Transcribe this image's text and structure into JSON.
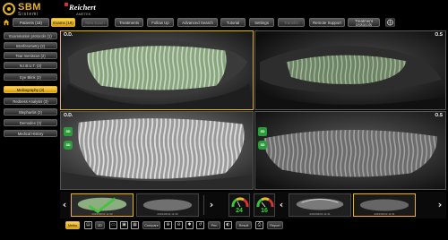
{
  "app": {
    "brand": "SBM",
    "brand_sub": "Sistemi",
    "partner": "Reichert",
    "partner_sub": "AMETEK"
  },
  "tabs": [
    {
      "label": "Patients (18)",
      "state": "normal"
    },
    {
      "label": "Exams (19)",
      "state": "active"
    },
    {
      "label": "New Exam",
      "state": "disabled"
    },
    {
      "label": "Treatments",
      "state": "normal"
    },
    {
      "label": "Follow Up",
      "state": "normal"
    },
    {
      "label": "Advanced Search",
      "state": "normal"
    },
    {
      "label": "Tutorial",
      "state": "normal"
    },
    {
      "label": "Settings",
      "state": "normal"
    },
    {
      "label": "Transfer",
      "state": "disabled"
    },
    {
      "label": "Remote Support",
      "state": "normal"
    },
    {
      "label_line1": "Treatment",
      "label_line2": "protocols",
      "state": "normal"
    }
  ],
  "sidebar": {
    "items": [
      {
        "label": "Examination protocols (1)",
        "active": false
      },
      {
        "label": "Interferometry (2)",
        "active": false
      },
      {
        "label": "Tear meniscus (2)",
        "active": false
      },
      {
        "label": "N.I.B.U.T. (3)",
        "active": false
      },
      {
        "label": "Eye Blink (2)",
        "active": false
      },
      {
        "label": "Meibography (3)",
        "active": true
      },
      {
        "label": "Redness Analysis (3)",
        "active": false
      },
      {
        "label": "Blepharitis (2)",
        "active": false
      },
      {
        "label": "Demodex (3)",
        "active": false
      },
      {
        "label": "Medical History",
        "active": false
      }
    ]
  },
  "grid": {
    "cells": [
      {
        "eye": "O.D.",
        "kind": "upper-lid",
        "selected": true
      },
      {
        "eye": "O.S",
        "kind": "upper-lid-dark",
        "selected": false
      },
      {
        "eye": "O.D.",
        "kind": "lower-lid",
        "selected": false,
        "badge_top": "3D",
        "badge_bottom": "3D"
      },
      {
        "eye": "O.S",
        "kind": "lower-lid-dark",
        "selected": false,
        "badge_top": "3D",
        "badge_bottom": "3D"
      }
    ]
  },
  "strip": {
    "left_arrow": "‹",
    "right_arrow": "›",
    "thumbs_left": [
      {
        "caption": "2023/06/03 11:30",
        "selected": true,
        "checked": true
      },
      {
        "caption": "2023/06/03 11:30",
        "selected": false,
        "checked": false
      }
    ],
    "gauges": [
      {
        "value": "24"
      },
      {
        "value": "16"
      }
    ],
    "thumbs_right": [
      {
        "caption": "2023/06/03 11:31",
        "selected": false,
        "checked": false
      },
      {
        "caption": "2023/06/03 11:31",
        "selected": true,
        "checked": false
      }
    ]
  },
  "toolbar": {
    "mode": "Meibo",
    "buttons": [
      {
        "label": "Meibo",
        "active": true
      },
      {
        "label": "2D",
        "active": false
      },
      {
        "label": "Compare",
        "active": false
      },
      {
        "label": "Pen",
        "active": false
      },
      {
        "label": "Result",
        "active": false
      },
      {
        "label": "Report",
        "active": false
      }
    ]
  },
  "colors": {
    "accent": "#e8b31a",
    "green": "#2a9d3a",
    "background": "#000000"
  }
}
